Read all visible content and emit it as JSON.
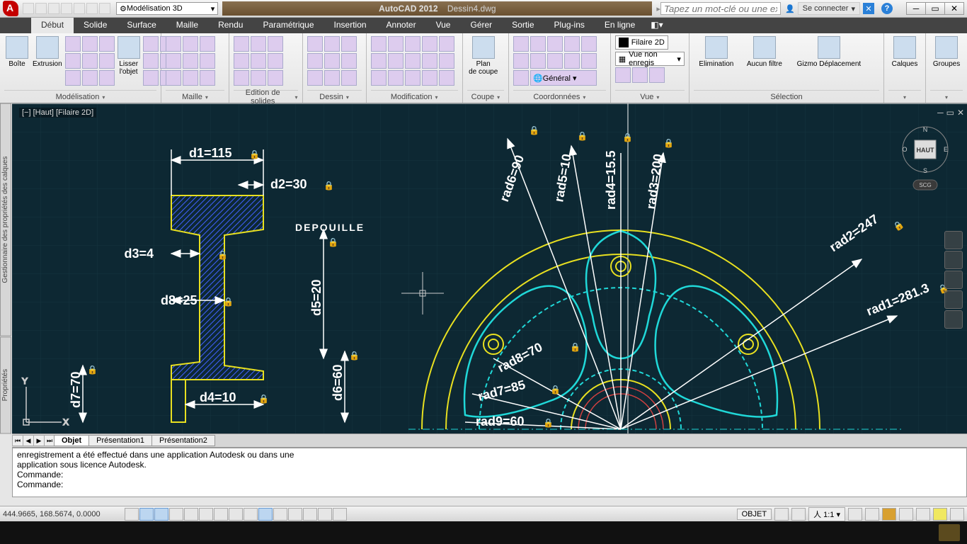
{
  "title": {
    "app": "AutoCAD 2012",
    "doc": "Dessin4.dwg"
  },
  "workspace": "Modélisation 3D",
  "search_placeholder": "Tapez un mot-clé ou une expression",
  "signin": "Se connecter",
  "tabs": [
    "Début",
    "Solide",
    "Surface",
    "Maille",
    "Rendu",
    "Paramétrique",
    "Insertion",
    "Annoter",
    "Vue",
    "Gérer",
    "Sortie",
    "Plug-ins",
    "En ligne"
  ],
  "active_tab": 0,
  "panels": {
    "modelisation": {
      "title": "Modélisation",
      "btns": [
        {
          "label": "Boîte"
        },
        {
          "label": "Extrusion"
        },
        {
          "label": "Lisser\nl'objet"
        }
      ]
    },
    "maille": {
      "title": "Maille"
    },
    "edition": {
      "title": "Edition de solides"
    },
    "dessin": {
      "title": "Dessin"
    },
    "modification": {
      "title": "Modification"
    },
    "coupe": {
      "title": "Coupe",
      "btn": "Plan\nde coupe"
    },
    "coord": {
      "title": "Coordonnées"
    },
    "vue": {
      "title": "Vue",
      "style": "Filaire 2D",
      "unsaved": "Vue non enregis"
    },
    "selection": {
      "title": "Sélection",
      "btns": [
        "Elimination",
        "Aucun filtre",
        "Gizmo Déplacement"
      ]
    },
    "calques": {
      "title": "Calques"
    },
    "groupes": {
      "title": "Groupes"
    }
  },
  "side_tabs": [
    "Gestionnaire des propriétés des calques",
    "Propriétés"
  ],
  "viewport_label": "[−] [Haut] [Filaire 2D]",
  "viewcube": {
    "face": "HAUT",
    "n": "N",
    "s": "S",
    "e": "E",
    "o": "O",
    "scg": "SCG"
  },
  "sheet_tabs": [
    "Objet",
    "Présentation1",
    "Présentation2"
  ],
  "active_sheet": 0,
  "cmd": {
    "l1": "enregistrement a été effectué dans une application Autodesk ou dans une",
    "l2": "application sous licence Autodesk.",
    "l3": "Commande:",
    "l4": "",
    "l5": "Commande:"
  },
  "status": {
    "coords": "444.9665, 168.5674, 0.0000",
    "objet": "OBJET",
    "scale": "1:1",
    "general": "Général"
  },
  "dims": {
    "d1": "d1=115",
    "d2": "d2=30",
    "d3": "d3=4",
    "d4": "d4=10",
    "d5": "d5=20",
    "d6": "d6=60",
    "d7": "d7=70",
    "d8": "d8=25",
    "depouille": "DEPOUILLE",
    "r1": "rad1=281.3",
    "r2": "rad2=247",
    "r3": "rad3=200",
    "r4": "rad4=15.5",
    "r5": "rad5=10",
    "r6": "rad6=90",
    "r7": "rad7=85",
    "r8": "rad8=70",
    "r9": "rad9=60"
  }
}
